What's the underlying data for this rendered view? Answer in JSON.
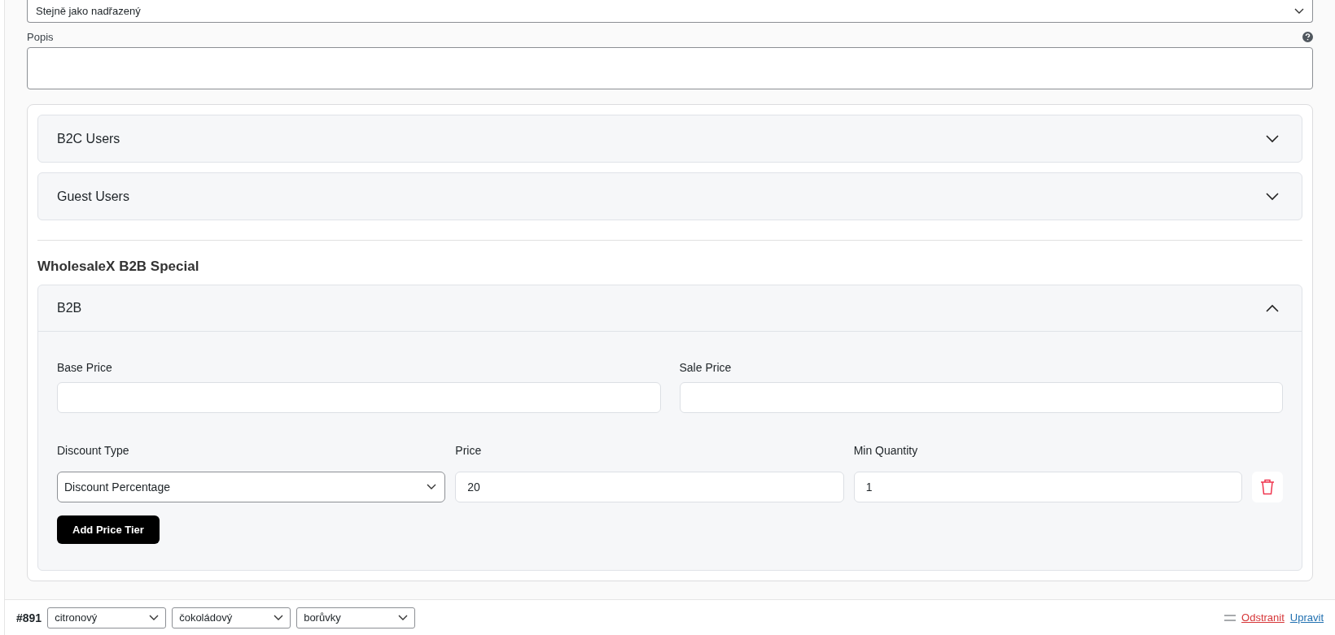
{
  "parent_select": {
    "value": "Stejně jako nadřazený"
  },
  "description": {
    "label": "Popis"
  },
  "role_groups": [
    {
      "title": "B2C Users",
      "expanded": false
    },
    {
      "title": "Guest Users",
      "expanded": false
    }
  ],
  "special_section": {
    "title": "WholesaleX B2B Special",
    "groups": [
      {
        "title": "B2B",
        "expanded": true,
        "base_price_label": "Base Price",
        "sale_price_label": "Sale Price",
        "tier_columns": [
          "Discount Type",
          "Price",
          "Min Quantity"
        ],
        "tiers": [
          {
            "discount_type": "Discount Percentage",
            "price": "20",
            "min_quantity": "1"
          }
        ],
        "add_button": "Add Price Tier"
      }
    ]
  },
  "variation": {
    "number": "#891",
    "attributes": [
      "citronový",
      "čokoládový",
      "borůvky"
    ],
    "remove_link": "Odstranit",
    "edit_link": "Upravit"
  }
}
